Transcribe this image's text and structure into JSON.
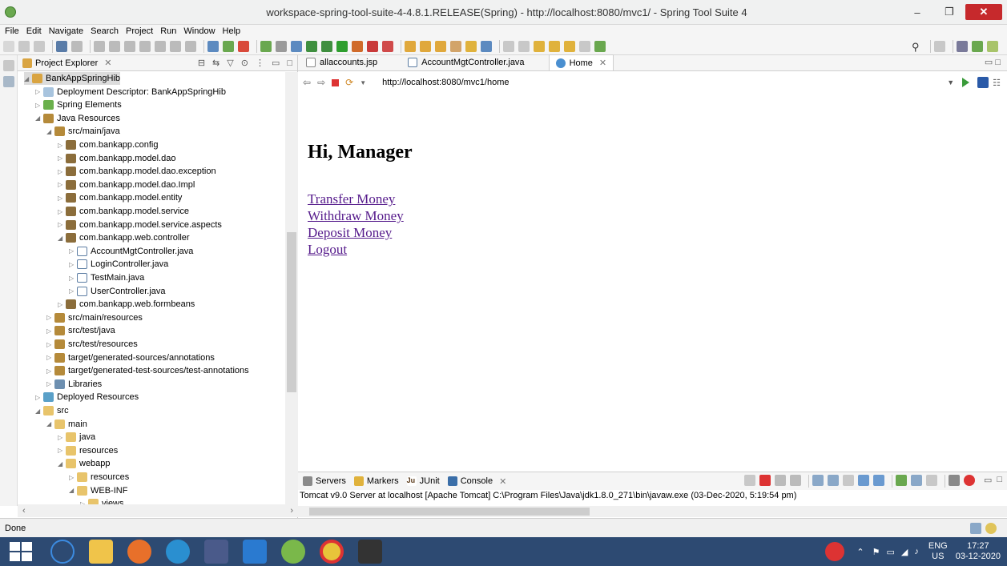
{
  "window": {
    "title": "workspace-spring-tool-suite-4-4.8.1.RELEASE(Spring) - http://localhost:8080/mvc1/ - Spring Tool Suite 4",
    "minimize": "–",
    "maximize": "❐",
    "close": "✕"
  },
  "menu": [
    "File",
    "Edit",
    "Navigate",
    "Search",
    "Project",
    "Run",
    "Window",
    "Help"
  ],
  "explorer": {
    "tab_label": "Project Explorer",
    "tree": [
      {
        "label": "BankAppSpringHib",
        "depth": 0,
        "expanded": true,
        "icon": "project-icon"
      },
      {
        "label": "Deployment Descriptor: BankAppSpringHib",
        "depth": 1,
        "expanded": false,
        "icon": "descriptor-icon"
      },
      {
        "label": "Spring Elements",
        "depth": 1,
        "expanded": false,
        "icon": "spring-icon"
      },
      {
        "label": "Java Resources",
        "depth": 1,
        "expanded": true,
        "icon": "source-folder-icon"
      },
      {
        "label": "src/main/java",
        "depth": 2,
        "expanded": true,
        "icon": "source-folder-icon"
      },
      {
        "label": "com.bankapp.config",
        "depth": 3,
        "expanded": false,
        "icon": "package-icon"
      },
      {
        "label": "com.bankapp.model.dao",
        "depth": 3,
        "expanded": false,
        "icon": "package-icon"
      },
      {
        "label": "com.bankapp.model.dao.exception",
        "depth": 3,
        "expanded": false,
        "icon": "package-icon"
      },
      {
        "label": "com.bankapp.model.dao.Impl",
        "depth": 3,
        "expanded": false,
        "icon": "package-icon"
      },
      {
        "label": "com.bankapp.model.entity",
        "depth": 3,
        "expanded": false,
        "icon": "package-icon"
      },
      {
        "label": "com.bankapp.model.service",
        "depth": 3,
        "expanded": false,
        "icon": "package-icon"
      },
      {
        "label": "com.bankapp.model.service.aspects",
        "depth": 3,
        "expanded": false,
        "icon": "package-icon"
      },
      {
        "label": "com.bankapp.web.controller",
        "depth": 3,
        "expanded": true,
        "icon": "package-icon"
      },
      {
        "label": "AccountMgtController.java",
        "depth": 4,
        "expanded": false,
        "icon": "java-file-icon"
      },
      {
        "label": "LoginController.java",
        "depth": 4,
        "expanded": false,
        "icon": "java-file-icon"
      },
      {
        "label": "TestMain.java",
        "depth": 4,
        "expanded": false,
        "icon": "java-file-icon"
      },
      {
        "label": "UserController.java",
        "depth": 4,
        "expanded": false,
        "icon": "java-file-icon"
      },
      {
        "label": "com.bankapp.web.formbeans",
        "depth": 3,
        "expanded": false,
        "icon": "package-icon"
      },
      {
        "label": "src/main/resources",
        "depth": 2,
        "expanded": false,
        "icon": "source-folder-icon"
      },
      {
        "label": "src/test/java",
        "depth": 2,
        "expanded": false,
        "icon": "source-folder-icon"
      },
      {
        "label": "src/test/resources",
        "depth": 2,
        "expanded": false,
        "icon": "source-folder-icon"
      },
      {
        "label": "target/generated-sources/annotations",
        "depth": 2,
        "expanded": false,
        "icon": "source-folder-icon"
      },
      {
        "label": "target/generated-test-sources/test-annotations",
        "depth": 2,
        "expanded": false,
        "icon": "source-folder-icon"
      },
      {
        "label": "Libraries",
        "depth": 2,
        "expanded": false,
        "icon": "library-icon"
      },
      {
        "label": "Deployed Resources",
        "depth": 1,
        "expanded": false,
        "icon": "deployed-icon"
      },
      {
        "label": "src",
        "depth": 1,
        "expanded": true,
        "icon": "folder-icon"
      },
      {
        "label": "main",
        "depth": 2,
        "expanded": true,
        "icon": "folder-icon"
      },
      {
        "label": "java",
        "depth": 3,
        "expanded": false,
        "icon": "folder-icon"
      },
      {
        "label": "resources",
        "depth": 3,
        "expanded": false,
        "icon": "folder-icon"
      },
      {
        "label": "webapp",
        "depth": 3,
        "expanded": true,
        "icon": "folder-icon"
      },
      {
        "label": "resources",
        "depth": 4,
        "expanded": false,
        "icon": "folder-icon"
      },
      {
        "label": "WEB-INF",
        "depth": 4,
        "expanded": true,
        "icon": "folder-icon"
      },
      {
        "label": "views",
        "depth": 5,
        "expanded": false,
        "icon": "folder-icon"
      }
    ]
  },
  "editor": {
    "tabs": [
      {
        "label": "allaccounts.jsp",
        "active": false
      },
      {
        "label": "AccountMgtController.java",
        "active": false
      },
      {
        "label": "Home",
        "active": true
      }
    ],
    "url": "http://localhost:8080/mvc1/home",
    "page": {
      "heading": "Hi, Manager",
      "links": [
        "Transfer Money",
        "Withdraw Money",
        "Deposit Money",
        "Logout"
      ]
    }
  },
  "console": {
    "tabs": [
      "Servers",
      "Markers",
      "JUnit",
      "Console"
    ],
    "line": "Tomcat v9.0 Server at localhost [Apache Tomcat] C:\\Program Files\\Java\\jdk1.8.0_271\\bin\\javaw.exe  (03-Dec-2020, 5:19:54 pm)"
  },
  "status": {
    "text": "Done"
  },
  "taskbar": {
    "apps": [
      "edge-legacy-icon",
      "file-explorer-icon",
      "firefox-icon",
      "edge-icon",
      "vscode-icon",
      "visual-studio-icon",
      "spring-tool-suite-icon",
      "chrome-icon",
      "mysql-icon"
    ],
    "lang_top": "ENG",
    "lang_bottom": "US",
    "time": "17:27",
    "date": "03-12-2020"
  },
  "colors": {
    "taskbar": "#2d4a72",
    "link": "#551a8b",
    "close": "#c6292c"
  }
}
